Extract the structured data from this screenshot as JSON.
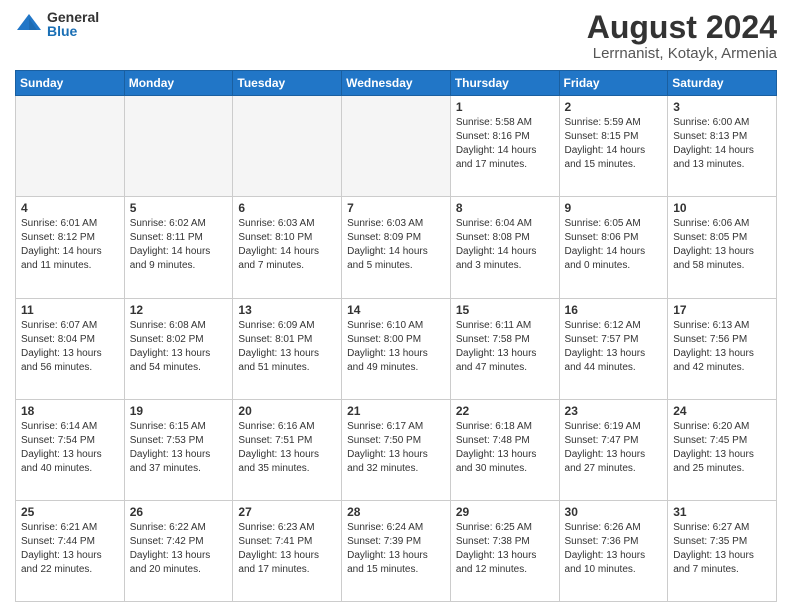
{
  "header": {
    "logo_general": "General",
    "logo_blue": "Blue",
    "title": "August 2024",
    "subtitle": "Lerrnanist, Kotayk, Armenia"
  },
  "days_of_week": [
    "Sunday",
    "Monday",
    "Tuesday",
    "Wednesday",
    "Thursday",
    "Friday",
    "Saturday"
  ],
  "weeks": [
    [
      {
        "day": "",
        "info": ""
      },
      {
        "day": "",
        "info": ""
      },
      {
        "day": "",
        "info": ""
      },
      {
        "day": "",
        "info": ""
      },
      {
        "day": "1",
        "info": "Sunrise: 5:58 AM\nSunset: 8:16 PM\nDaylight: 14 hours\nand 17 minutes."
      },
      {
        "day": "2",
        "info": "Sunrise: 5:59 AM\nSunset: 8:15 PM\nDaylight: 14 hours\nand 15 minutes."
      },
      {
        "day": "3",
        "info": "Sunrise: 6:00 AM\nSunset: 8:13 PM\nDaylight: 14 hours\nand 13 minutes."
      }
    ],
    [
      {
        "day": "4",
        "info": "Sunrise: 6:01 AM\nSunset: 8:12 PM\nDaylight: 14 hours\nand 11 minutes."
      },
      {
        "day": "5",
        "info": "Sunrise: 6:02 AM\nSunset: 8:11 PM\nDaylight: 14 hours\nand 9 minutes."
      },
      {
        "day": "6",
        "info": "Sunrise: 6:03 AM\nSunset: 8:10 PM\nDaylight: 14 hours\nand 7 minutes."
      },
      {
        "day": "7",
        "info": "Sunrise: 6:03 AM\nSunset: 8:09 PM\nDaylight: 14 hours\nand 5 minutes."
      },
      {
        "day": "8",
        "info": "Sunrise: 6:04 AM\nSunset: 8:08 PM\nDaylight: 14 hours\nand 3 minutes."
      },
      {
        "day": "9",
        "info": "Sunrise: 6:05 AM\nSunset: 8:06 PM\nDaylight: 14 hours\nand 0 minutes."
      },
      {
        "day": "10",
        "info": "Sunrise: 6:06 AM\nSunset: 8:05 PM\nDaylight: 13 hours\nand 58 minutes."
      }
    ],
    [
      {
        "day": "11",
        "info": "Sunrise: 6:07 AM\nSunset: 8:04 PM\nDaylight: 13 hours\nand 56 minutes."
      },
      {
        "day": "12",
        "info": "Sunrise: 6:08 AM\nSunset: 8:02 PM\nDaylight: 13 hours\nand 54 minutes."
      },
      {
        "day": "13",
        "info": "Sunrise: 6:09 AM\nSunset: 8:01 PM\nDaylight: 13 hours\nand 51 minutes."
      },
      {
        "day": "14",
        "info": "Sunrise: 6:10 AM\nSunset: 8:00 PM\nDaylight: 13 hours\nand 49 minutes."
      },
      {
        "day": "15",
        "info": "Sunrise: 6:11 AM\nSunset: 7:58 PM\nDaylight: 13 hours\nand 47 minutes."
      },
      {
        "day": "16",
        "info": "Sunrise: 6:12 AM\nSunset: 7:57 PM\nDaylight: 13 hours\nand 44 minutes."
      },
      {
        "day": "17",
        "info": "Sunrise: 6:13 AM\nSunset: 7:56 PM\nDaylight: 13 hours\nand 42 minutes."
      }
    ],
    [
      {
        "day": "18",
        "info": "Sunrise: 6:14 AM\nSunset: 7:54 PM\nDaylight: 13 hours\nand 40 minutes."
      },
      {
        "day": "19",
        "info": "Sunrise: 6:15 AM\nSunset: 7:53 PM\nDaylight: 13 hours\nand 37 minutes."
      },
      {
        "day": "20",
        "info": "Sunrise: 6:16 AM\nSunset: 7:51 PM\nDaylight: 13 hours\nand 35 minutes."
      },
      {
        "day": "21",
        "info": "Sunrise: 6:17 AM\nSunset: 7:50 PM\nDaylight: 13 hours\nand 32 minutes."
      },
      {
        "day": "22",
        "info": "Sunrise: 6:18 AM\nSunset: 7:48 PM\nDaylight: 13 hours\nand 30 minutes."
      },
      {
        "day": "23",
        "info": "Sunrise: 6:19 AM\nSunset: 7:47 PM\nDaylight: 13 hours\nand 27 minutes."
      },
      {
        "day": "24",
        "info": "Sunrise: 6:20 AM\nSunset: 7:45 PM\nDaylight: 13 hours\nand 25 minutes."
      }
    ],
    [
      {
        "day": "25",
        "info": "Sunrise: 6:21 AM\nSunset: 7:44 PM\nDaylight: 13 hours\nand 22 minutes."
      },
      {
        "day": "26",
        "info": "Sunrise: 6:22 AM\nSunset: 7:42 PM\nDaylight: 13 hours\nand 20 minutes."
      },
      {
        "day": "27",
        "info": "Sunrise: 6:23 AM\nSunset: 7:41 PM\nDaylight: 13 hours\nand 17 minutes."
      },
      {
        "day": "28",
        "info": "Sunrise: 6:24 AM\nSunset: 7:39 PM\nDaylight: 13 hours\nand 15 minutes."
      },
      {
        "day": "29",
        "info": "Sunrise: 6:25 AM\nSunset: 7:38 PM\nDaylight: 13 hours\nand 12 minutes."
      },
      {
        "day": "30",
        "info": "Sunrise: 6:26 AM\nSunset: 7:36 PM\nDaylight: 13 hours\nand 10 minutes."
      },
      {
        "day": "31",
        "info": "Sunrise: 6:27 AM\nSunset: 7:35 PM\nDaylight: 13 hours\nand 7 minutes."
      }
    ]
  ]
}
